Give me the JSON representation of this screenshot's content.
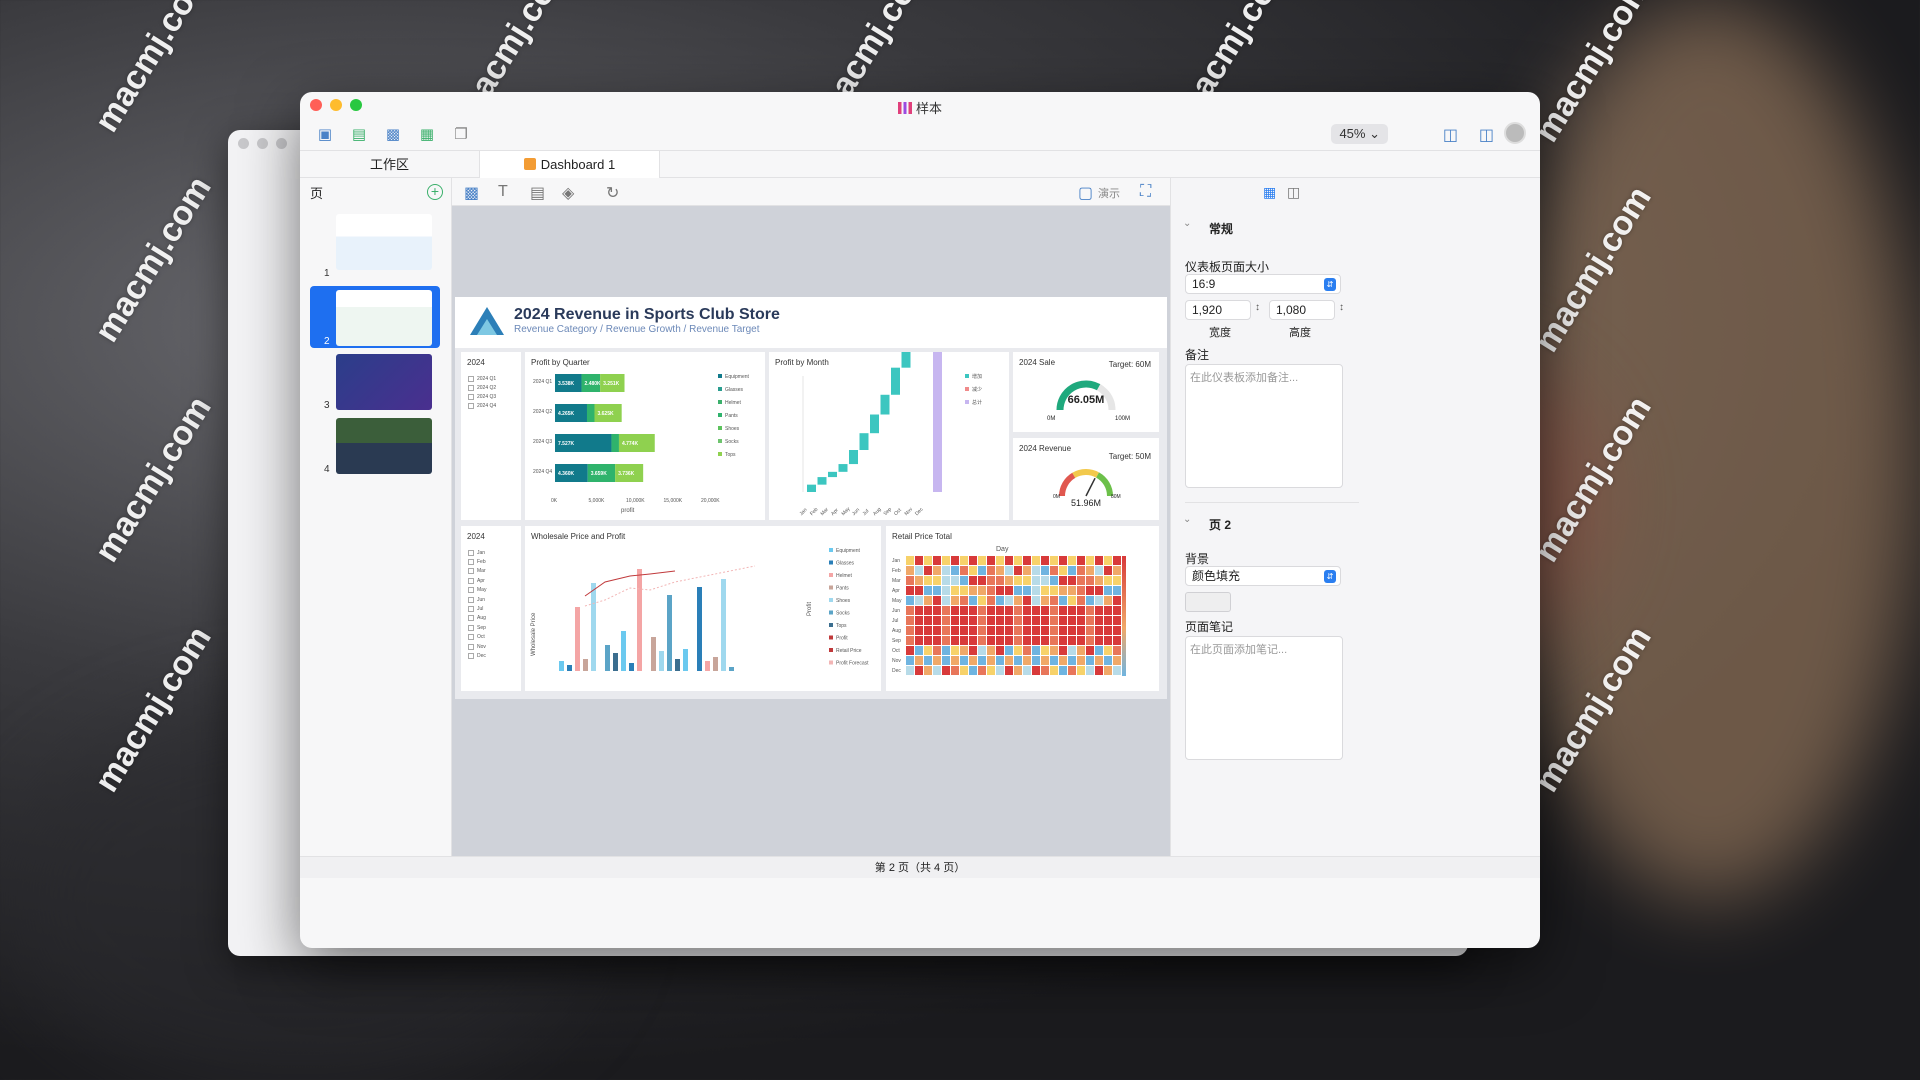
{
  "window": {
    "title": "样本"
  },
  "toolbar": {
    "zoom": "45%"
  },
  "tabs": [
    {
      "label": "工作区"
    },
    {
      "label": "Dashboard 1"
    }
  ],
  "pages_panel": {
    "header": "页",
    "numbers": [
      "1",
      "2",
      "3",
      "4"
    ]
  },
  "canvas_toolbar": {
    "present_label": "演示"
  },
  "dashboard": {
    "title": "2024 Revenue in Sports Club Store",
    "subtitle": "Revenue Category / Revenue Growth / Revenue Target",
    "filter1": {
      "title": "2024",
      "items": [
        "2024 Q1",
        "2024 Q2",
        "2024 Q3",
        "2024 Q4"
      ]
    },
    "profit_by_quarter": {
      "title": "Profit by Quarter",
      "xlabel": "profit"
    },
    "profit_by_month": {
      "title": "Profit by Month"
    },
    "gauge1": {
      "title": "2024 Sale",
      "target": "Target: 60M",
      "value": "66.05M",
      "min": "0M",
      "max": "100M"
    },
    "gauge2": {
      "title": "2024 Revenue",
      "target": "Target: 50M",
      "value": "51.96M",
      "min": "0M",
      "max": "80M"
    },
    "filter2": {
      "title": "2024",
      "items": [
        "Jan",
        "Feb",
        "Mar",
        "Apr",
        "May",
        "Jun",
        "Jul",
        "Aug",
        "Sep",
        "Oct",
        "Nov",
        "Dec"
      ]
    },
    "wholesale": {
      "title": "Wholesale Price and Profit",
      "ylabel": "Wholesale Price",
      "y2label": "Profit"
    },
    "retail": {
      "title": "Retail Price Total",
      "xlabel": "Day"
    },
    "legend_products": [
      "Equipment",
      "Glasses",
      "Helmet",
      "Pants",
      "Shoes",
      "Socks",
      "Tops"
    ],
    "legend_month": [
      "增加",
      "减少",
      "总计"
    ],
    "legend_wholesale": [
      "Equipment",
      "Glasses",
      "Helmet",
      "Pants",
      "Shoes",
      "Socks",
      "Tops",
      "Profit",
      "Retail Price",
      "Profit Forecast"
    ]
  },
  "props": {
    "section_general": "常规",
    "page_size_label": "仪表板页面大小",
    "page_size_value": "16:9",
    "width_value": "1,920",
    "height_value": "1,080",
    "width_label": "宽度",
    "height_label": "高度",
    "notes_label": "备注",
    "notes_placeholder": "在此仪表板添加备注...",
    "section_page": "页 2",
    "bg_label": "背景",
    "bg_value": "颜色填充",
    "page_notes_label": "页面笔记",
    "page_notes_placeholder": "在此页面添加笔记..."
  },
  "status": "第 2 页（共 4 页）",
  "watermark": "macmj.com",
  "chart_data": [
    {
      "type": "bar",
      "title": "Profit by Quarter",
      "xlabel": "profit",
      "categories": [
        "2024 Q1",
        "2024 Q2",
        "2024 Q3",
        "2024 Q4"
      ],
      "series": [
        {
          "name": "Equipment",
          "values": [
            3538,
            4265,
            7527,
            4360
          ]
        },
        {
          "name": "Glasses",
          "values": [
            2480,
            1000,
            1000,
            3659
          ]
        },
        {
          "name": "Tops",
          "values": [
            3251,
            3625,
            4774,
            3736
          ]
        }
      ],
      "xlim": [
        0,
        20000
      ]
    },
    {
      "type": "bar",
      "title": "Profit by Month",
      "categories": [
        "Jan",
        "Feb",
        "Mar",
        "Apr",
        "May",
        "Jun",
        "Jul",
        "Aug",
        "Sep",
        "Oct",
        "Nov",
        "Dec"
      ],
      "values": [
        3.5,
        3.6,
        2.5,
        3.7,
        6.7,
        8.0,
        8.9,
        9.4,
        12.9,
        11.1,
        12.1,
        -4.5
      ],
      "ylim": [
        0,
        60000
      ]
    },
    {
      "type": "gauge",
      "title": "2024 Sale",
      "value": 66.05,
      "min": 0,
      "max": 100,
      "target": 60
    },
    {
      "type": "gauge",
      "title": "2024 Revenue",
      "value": 51.96,
      "min": 0,
      "max": 80,
      "target": 50
    }
  ]
}
